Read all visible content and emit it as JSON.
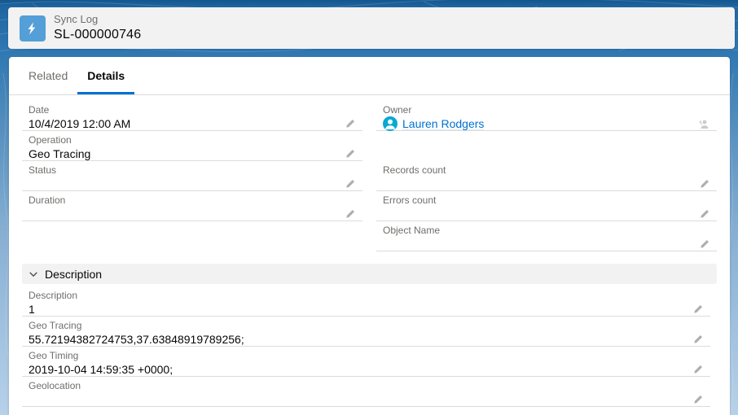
{
  "header": {
    "object_label": "Sync Log",
    "record_name": "SL-000000746",
    "icon": "lightning-bolt-icon"
  },
  "tabs": {
    "related": "Related",
    "details": "Details"
  },
  "details": {
    "fields": [
      {
        "label": "Date",
        "value": "10/4/2019 12:00 AM"
      },
      {
        "label": "Owner",
        "value": "Lauren Rodgers"
      },
      {
        "label": "Operation",
        "value": "Geo Tracing"
      },
      {
        "label": "Status",
        "value": ""
      },
      {
        "label": "Records count",
        "value": ""
      },
      {
        "label": "Duration",
        "value": ""
      },
      {
        "label": "Errors count",
        "value": ""
      },
      {
        "label": "Object Name",
        "value": ""
      }
    ]
  },
  "description_section": {
    "title": "Description",
    "fields": [
      {
        "label": "Description",
        "value": "1"
      },
      {
        "label": "Geo Tracing",
        "value": "55.72194382724753,37.63848919789256;"
      },
      {
        "label": "Geo Timing",
        "value": "2019-10-04 14:59:35 +0000;"
      },
      {
        "label": "Geolocation",
        "value": ""
      }
    ]
  },
  "colors": {
    "accent_link": "#0070d2",
    "tab_underline": "#0070d2",
    "record_icon_bg": "#549fd7",
    "avatar_bg": "#09a9d0",
    "background_top": "#14578f",
    "background_bottom": "#b7d1e9",
    "card_bg": "#ffffff",
    "header_card_bg": "#f3f2f2",
    "divider": "#dddbda",
    "label_text": "#706e6b",
    "value_text": "#080707"
  }
}
